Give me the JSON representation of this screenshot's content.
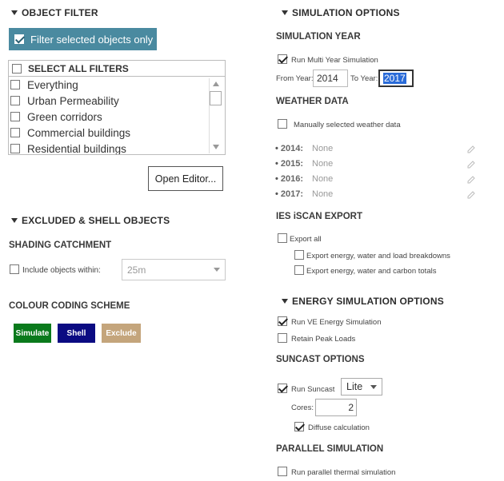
{
  "left": {
    "object_filter": {
      "title": "OBJECT FILTER",
      "filter_selected_label": "Filter selected objects only",
      "select_all_label": "SELECT ALL FILTERS",
      "items": [
        "Everything",
        "Urban Permeability",
        "Green corridors",
        "Commercial buildings",
        "Residential buildings"
      ],
      "open_editor_label": "Open Editor..."
    },
    "excluded_shell": {
      "title": "EXCLUDED & SHELL OBJECTS"
    },
    "shading_catchment": {
      "title": "SHADING CATCHMENT",
      "include_label": "Include objects within:",
      "distance_value": "25m"
    },
    "colour_coding": {
      "title": "COLOUR CODING SCHEME",
      "simulate_label": "Simulate",
      "shell_label": "Shell",
      "exclude_label": "Exclude",
      "simulate_color": "#0a7a1c",
      "shell_color": "#0b0b82",
      "exclude_color": "#c4a57c"
    }
  },
  "right": {
    "simulation_options": {
      "title": "SIMULATION OPTIONS"
    },
    "simulation_year": {
      "title": "SIMULATION YEAR",
      "multi_year_label": "Run Multi Year Simulation",
      "from_label": "From Year:",
      "from_value": "2014",
      "to_label": "To Year:",
      "to_value": "2017"
    },
    "weather_data": {
      "title": "WEATHER DATA",
      "manual_label": "Manually selected weather data",
      "rows": [
        {
          "year": "2014:",
          "value": "None"
        },
        {
          "year": "2015:",
          "value": "None"
        },
        {
          "year": "2016:",
          "value": "None"
        },
        {
          "year": "2017:",
          "value": "None"
        }
      ]
    },
    "ies_export": {
      "title": "IES iSCAN EXPORT",
      "export_all_label": "Export all",
      "export_energy_label": "Export energy, water and load breakdowns",
      "export_carbon_label": "Export energy, water and carbon totals"
    },
    "energy_simulation": {
      "title": "ENERGY SIMULATION OPTIONS",
      "run_ve_label": "Run VE Energy Simulation",
      "retain_peak_label": "Retain Peak Loads"
    },
    "suncast": {
      "title": "SUNCAST OPTIONS",
      "run_label": "Run Suncast",
      "mode_value": "Lite",
      "cores_label": "Cores:",
      "cores_value": "2",
      "diffuse_label": "Diffuse calculation"
    },
    "parallel": {
      "title": "PARALLEL SIMULATION",
      "run_parallel_label": "Run parallel thermal simulation"
    }
  }
}
